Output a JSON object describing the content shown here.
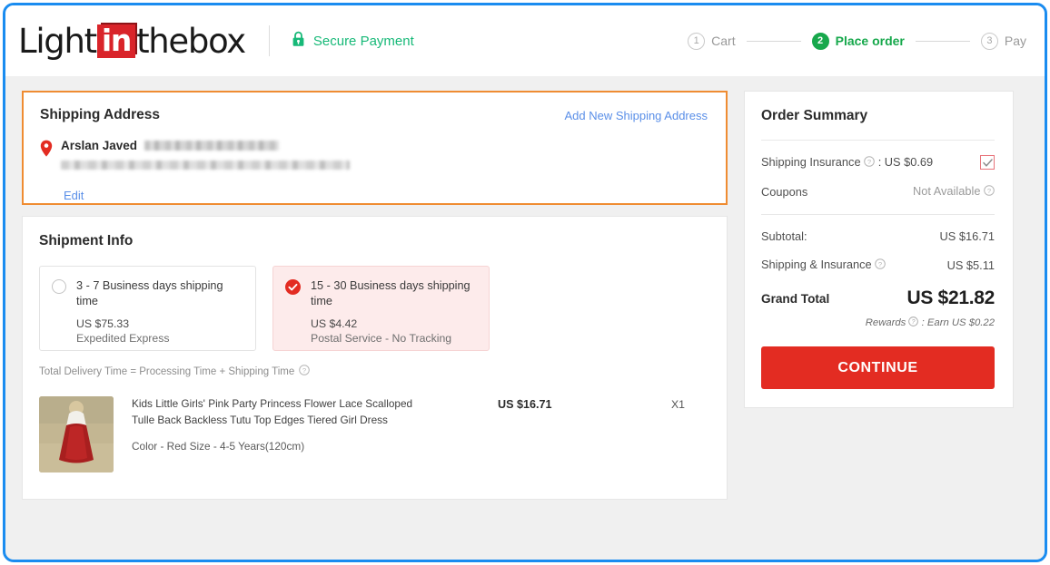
{
  "header": {
    "logo": {
      "part1": "Light",
      "part2": "in",
      "part3": "thebox"
    },
    "secure_payment": "Secure Payment",
    "lock_icon": "lock-icon",
    "steps": [
      {
        "num": "1",
        "label": "Cart",
        "active": false
      },
      {
        "num": "2",
        "label": "Place order",
        "active": true
      },
      {
        "num": "3",
        "label": "Pay",
        "active": false
      }
    ]
  },
  "shipping_address": {
    "title": "Shipping Address",
    "add_new_link": "Add New Shipping Address",
    "pin_icon": "map-pin-icon",
    "recipient_name": "Arslan Javed",
    "phone_redacted": "",
    "address_redacted": "",
    "edit_link": "Edit"
  },
  "shipment_info": {
    "title": "Shipment Info",
    "options": [
      {
        "title": "3 - 7 Business days shipping time",
        "price": "US $75.33",
        "carrier": "Expedited Express",
        "selected": false
      },
      {
        "title": "15 - 30 Business days shipping time",
        "price": "US $4.42",
        "carrier": "Postal Service - No Tracking",
        "selected": true
      }
    ],
    "delivery_note": "Total Delivery Time = Processing Time + Shipping Time",
    "help_icon": "question-mark-icon"
  },
  "product": {
    "title": "Kids Little Girls' Pink Party Princess Flower Lace Scalloped Tulle Back Backless Tutu Top Edges Tiered Girl Dress",
    "variant": "Color - Red  Size - 4-5 Years(120cm)",
    "price": "US $16.71",
    "quantity": "X1",
    "thumbnail_alt": "girl-in-red-dress-thumbnail"
  },
  "order_summary": {
    "title": "Order Summary",
    "shipping_insurance_label": "Shipping Insurance",
    "shipping_insurance_value": ": US $0.69",
    "shipping_insurance_checked": true,
    "coupons_label": "Coupons",
    "coupons_value": "Not Available",
    "subtotal_label": "Subtotal:",
    "subtotal_value": "US $16.71",
    "shipping_insurance_row_label": "Shipping & Insurance",
    "shipping_insurance_row_value": "US $5.11",
    "grand_total_label": "Grand Total",
    "grand_total_value": "US $21.82",
    "rewards_prefix": "Rewards",
    "rewards_text": ": Earn US $0.22",
    "continue_button": "CONTINUE"
  },
  "colors": {
    "brand_red": "#d9242a",
    "secure_green": "#17b978",
    "step_active_green": "#17a84c",
    "link_blue": "#5a8fe8",
    "highlight_orange": "#ef8c32",
    "continue_red": "#e32c22",
    "frame_blue": "#1a8cf0"
  }
}
